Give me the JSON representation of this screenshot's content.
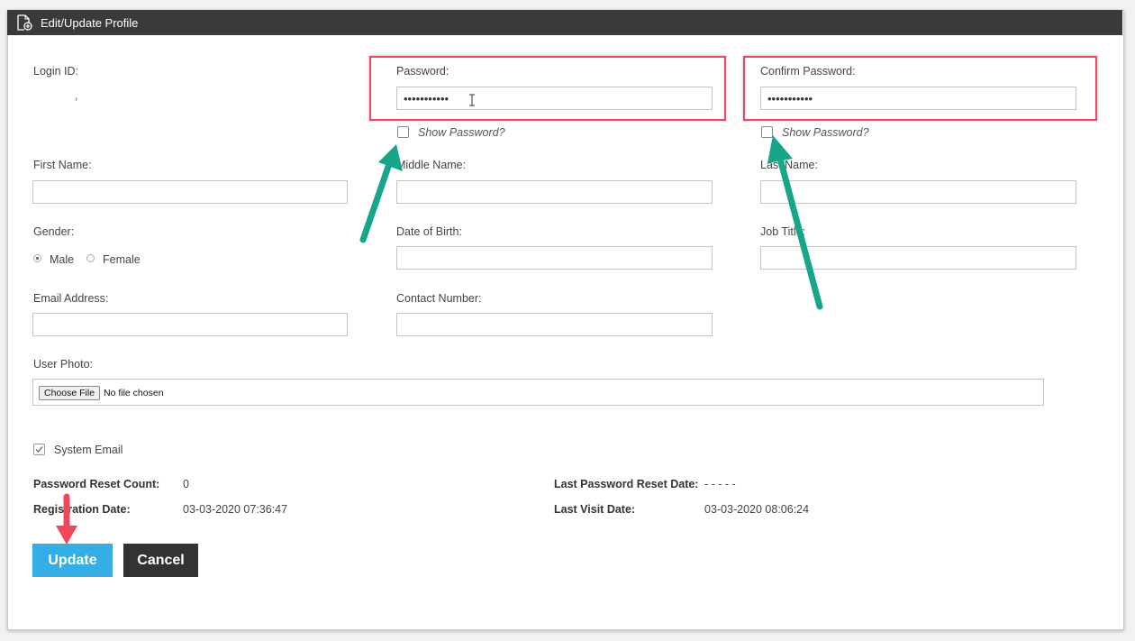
{
  "window": {
    "title": "Edit/Update Profile",
    "icon": "document-add-icon"
  },
  "form": {
    "login_id_label": "Login ID:",
    "login_id_value": ",",
    "password_label": "Password:",
    "password_value": "•••••••••••",
    "confirm_password_label": "Confirm Password:",
    "confirm_password_value": "•••••••••••",
    "show_password_label": "Show Password?",
    "first_name_label": "First Name:",
    "first_name_value": "",
    "middle_name_label": "Middle Name:",
    "middle_name_value": "",
    "last_name_label": "Last Name:",
    "last_name_value": "",
    "gender_label": "Gender:",
    "gender_options": [
      "Male",
      "Female"
    ],
    "gender_selected": "Male",
    "dob_label": "Date of Birth:",
    "dob_value": "",
    "job_title_label": "Job Title:",
    "job_title_value": "",
    "email_label": "Email Address:",
    "email_value": "",
    "contact_label": "Contact Number:",
    "contact_value": "",
    "photo_label": "User Photo:",
    "choose_file_label": "Choose File",
    "no_file_label": "No file chosen",
    "system_email_label": "System Email",
    "system_email_checked": true
  },
  "info": {
    "reset_count_label": "Password Reset Count:",
    "reset_count_value": "0",
    "last_reset_label": "Last Password Reset Date:",
    "last_reset_value": "- - - - -",
    "registration_label": "Registration Date:",
    "registration_value": "03-03-2020 07:36:47",
    "last_visit_label": "Last Visit Date:",
    "last_visit_value": "03-03-2020 08:06:24"
  },
  "buttons": {
    "update_label": "Update",
    "cancel_label": "Cancel"
  },
  "colors": {
    "header": "#3a3a3a",
    "update_button": "#33aee6",
    "cancel_button": "#333333",
    "highlight_box": "#e84a5f",
    "green_arrow": "#17a689",
    "red_arrow": "#f0465a"
  }
}
